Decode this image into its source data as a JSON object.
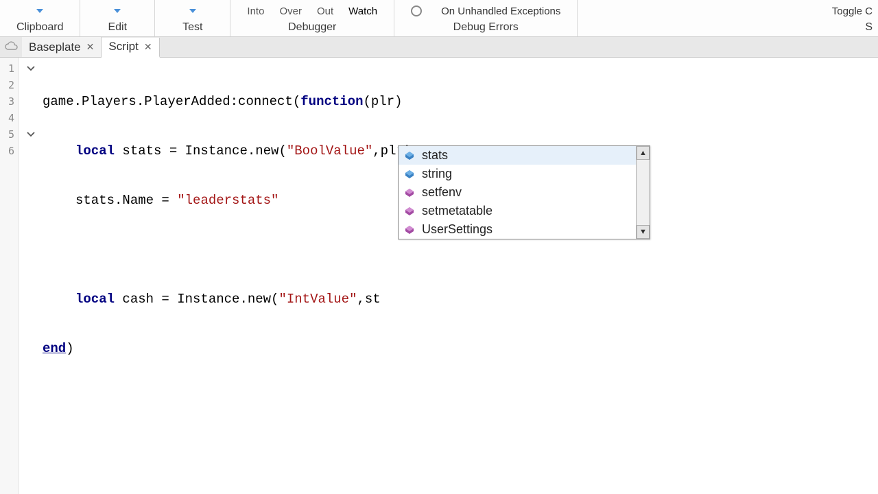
{
  "ribbon": {
    "groups": [
      {
        "label": "Clipboard"
      },
      {
        "label": "Edit"
      },
      {
        "label": "Test"
      },
      {
        "label": "Debugger",
        "items": [
          "Into",
          "Over",
          "Out",
          "Watch"
        ]
      },
      {
        "label": "Debug Errors",
        "checkbox_label": "On Unhandled Exceptions"
      },
      {
        "label_cut": "Toggle C",
        "sub_cut": "S"
      }
    ]
  },
  "tabs": [
    {
      "label": "Baseplate",
      "active": false
    },
    {
      "label": "Script",
      "active": true
    }
  ],
  "code": {
    "lines": [
      {
        "n": "1",
        "fold": "v"
      },
      {
        "n": "2",
        "fold": ""
      },
      {
        "n": "3",
        "fold": ""
      },
      {
        "n": "4",
        "fold": ""
      },
      {
        "n": "5",
        "fold": "v"
      },
      {
        "n": "6",
        "fold": ""
      }
    ],
    "tokens": {
      "l1_game": "game.Players.PlayerAdded:connect(",
      "l1_func": "function",
      "l1_plr": "(plr)",
      "l2_local": "local",
      "l2_rest1": " stats = Instance.new(",
      "l2_str": "\"BoolValue\"",
      "l2_rest2": ",plr)",
      "l3_name": "stats.Name = ",
      "l3_str": "\"leaderstats\"",
      "l5_local": "local",
      "l5_rest1": " cash = Instance.new(",
      "l5_str": "\"IntValue\"",
      "l5_rest2": ",st",
      "l6_end": "end",
      "l6_paren": ")"
    }
  },
  "autocomplete": {
    "items": [
      {
        "label": "stats",
        "kind": "var",
        "selected": true
      },
      {
        "label": "string",
        "kind": "var",
        "selected": false
      },
      {
        "label": "setfenv",
        "kind": "func",
        "selected": false
      },
      {
        "label": "setmetatable",
        "kind": "func",
        "selected": false
      },
      {
        "label": "UserSettings",
        "kind": "func",
        "selected": false
      }
    ]
  }
}
